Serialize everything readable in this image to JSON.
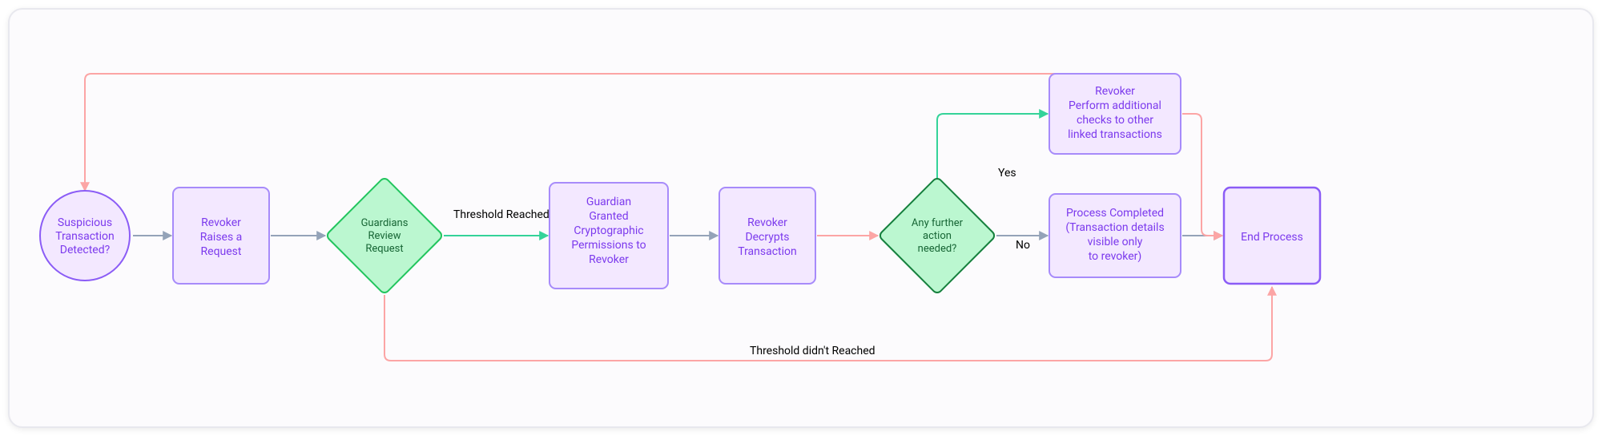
{
  "nodes": {
    "start": {
      "l1": "Suspicious",
      "l2": "Transaction",
      "l3": "Detected?"
    },
    "raise": {
      "l1": "Revoker",
      "l2": "Raises a",
      "l3": "Request"
    },
    "review": {
      "l1": "Guardians",
      "l2": "Review",
      "l3": "Request"
    },
    "granted": {
      "l1": "Guardian",
      "l2": "Granted",
      "l3": "Cryptographic",
      "l4": "Permissions to",
      "l5": "Revoker"
    },
    "decrypt": {
      "l1": "Revoker",
      "l2": "Decrypts",
      "l3": "Transaction"
    },
    "further": {
      "l1": "Any further",
      "l2": "action",
      "l3": "needed?"
    },
    "addchecks": {
      "l1": "Revoker",
      "l2": "Perform additional",
      "l3": "checks to other",
      "l4": "linked transactions"
    },
    "completed": {
      "l1": "Process Completed",
      "l2": "(Transaction details",
      "l3": "visible only",
      "l4": "to revoker)"
    },
    "end": {
      "l1": "End Process"
    }
  },
  "edges": {
    "threshold_reached": "Threshold Reached",
    "threshold_not": "Threshold didn't Reached",
    "yes": "Yes",
    "no": "No"
  }
}
